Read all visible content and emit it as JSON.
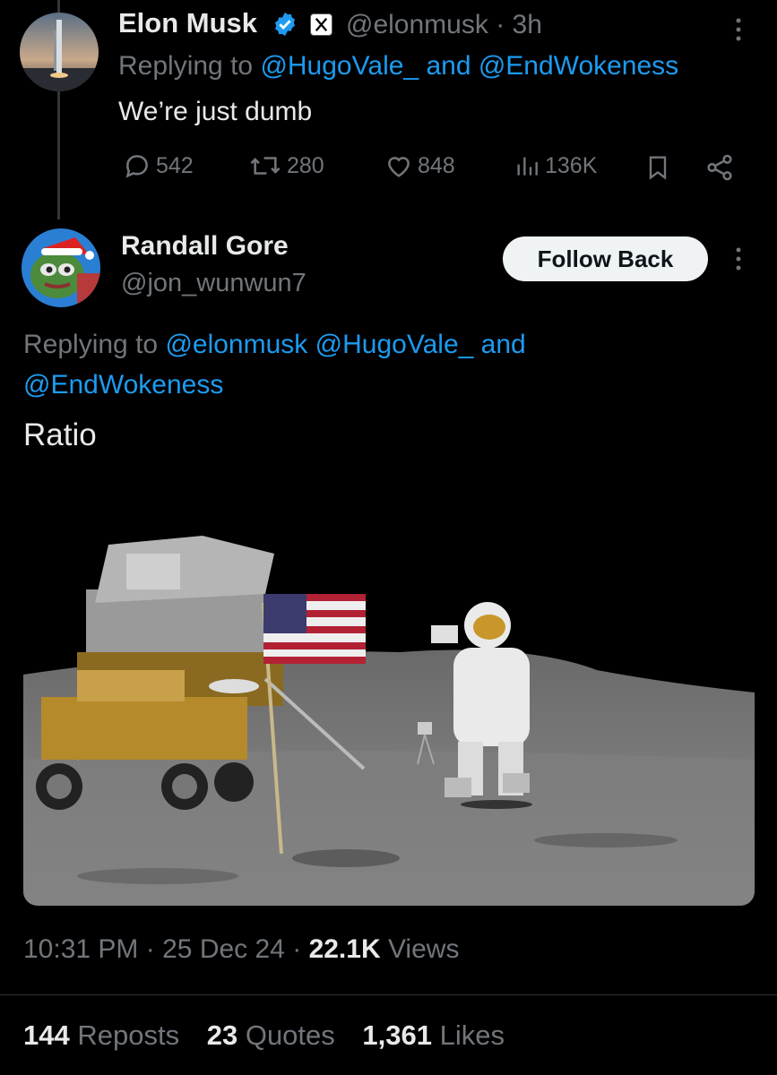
{
  "parent_tweet": {
    "author_name": "Elon Musk",
    "handle": "@elonmusk",
    "time": "3h",
    "replying_prefix": "Replying to ",
    "replying_to": "@HugoVale_ and @EndWokeness",
    "text": "We’re just dumb",
    "actions": {
      "replies": "542",
      "retweets": "280",
      "likes": "848",
      "views": "136K"
    },
    "icons": [
      "verified-badge-icon",
      "x-affiliate-icon",
      "more-icon",
      "reply-icon",
      "retweet-icon",
      "like-icon",
      "views-icon",
      "bookmark-icon",
      "share-icon"
    ]
  },
  "reply_tweet": {
    "author_name": "Randall Gore",
    "handle": "@jon_wunwun7",
    "follow_button": "Follow Back",
    "replying_prefix": "Replying to ",
    "replying_to_1": "@elonmusk",
    "replying_to_2": "@HugoVale_",
    "replying_and": "and",
    "replying_to_3": "@EndWokeness",
    "text": "Ratio",
    "meta": {
      "time": "10:31 PM",
      "sep": "·",
      "date": "25 Dec 24",
      "views_count": "22.1K",
      "views_label": "Views"
    },
    "stats": {
      "reposts_count": "144",
      "reposts_label": "Reposts",
      "quotes_count": "23",
      "quotes_label": "Quotes",
      "likes_count": "1,361",
      "likes_label": "Likes"
    }
  },
  "colors": {
    "background": "#000000",
    "text": "#e7e9ea",
    "secondary": "#71767b",
    "link": "#1d9bf0",
    "follow_button_bg": "#eff3f4"
  }
}
